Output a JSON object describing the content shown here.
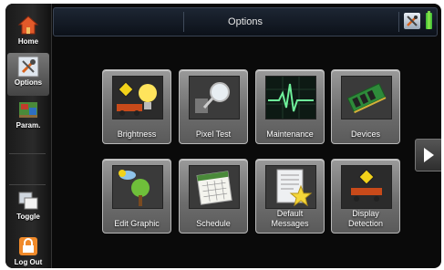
{
  "header": {
    "title": "Options"
  },
  "sidebar": {
    "items": [
      {
        "label": "Home"
      },
      {
        "label": "Options"
      },
      {
        "label": "Param."
      },
      {
        "label": "Toggle"
      },
      {
        "label": "Log Out"
      }
    ]
  },
  "tiles": [
    {
      "label": "Brightness"
    },
    {
      "label": "Pixel Test"
    },
    {
      "label": "Maintenance"
    },
    {
      "label": "Devices"
    },
    {
      "label": "Edit Graphic"
    },
    {
      "label": "Schedule"
    },
    {
      "label": "Default Messages"
    },
    {
      "label": "Display Detection"
    }
  ]
}
